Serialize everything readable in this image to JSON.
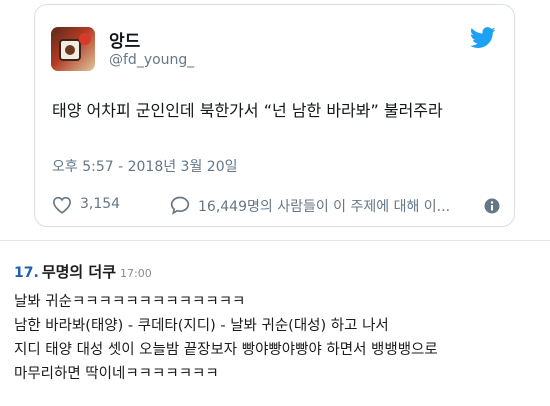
{
  "tweet": {
    "display_name": "앙드",
    "handle": "@fd_young_",
    "text": "태양 어차피 군인인데 북한가서 “넌 남한 바라봐” 불러주라",
    "time": "오후 5:57 - 2018년 3월 20일",
    "likes": "3,154",
    "people_talking": "16,449명의 사람들이 이 주제에 대해 이..."
  },
  "comment": {
    "number": "17.",
    "author": "무명의 더쿠",
    "time": "17:00",
    "lines": [
      "날봐 귀순ㅋㅋㅋㅋㅋㅋㅋㅋㅋㅋㅋㅋㅋ",
      "남한 바라봐(태양) - 쿠데타(지디) - 날봐 귀순(대성) 하고 나서",
      "지디 태양 대성 셋이 오늘밤 끝장보자 빵야빵야빵야 하면서 뱅뱅뱅으로",
      "마무리하면 딱이네ㅋㅋㅋㅋㅋㅋㅋ"
    ]
  },
  "colors": {
    "twitter_blue": "#1da1f2",
    "comment_number": "#1d5fb0",
    "secondary_text": "#657786"
  },
  "icons": [
    "twitter-bird-icon",
    "heart-icon",
    "speech-bubble-icon",
    "info-icon"
  ]
}
